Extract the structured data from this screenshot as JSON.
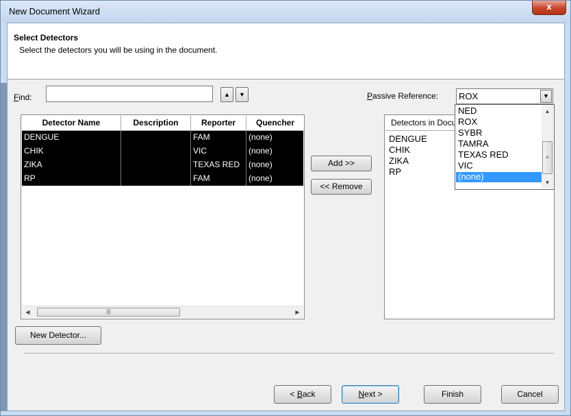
{
  "window": {
    "title": "New Document Wizard",
    "close_label": "x"
  },
  "header": {
    "title": "Select Detectors",
    "subtitle": "Select the detectors you will be using in the document."
  },
  "find": {
    "label_key": "F",
    "label_rest": "ind:",
    "value": "",
    "up_glyph": "▲",
    "down_glyph": "▼"
  },
  "passive_reference": {
    "label_key": "P",
    "label_rest": "assive Reference:",
    "selected": "ROX",
    "options": [
      "NED",
      "ROX",
      "SYBR",
      "TAMRA",
      "TEXAS RED",
      "VIC",
      "(none)"
    ],
    "highlighted": "(none)"
  },
  "detector_table": {
    "columns": [
      "Detector Name",
      "Description",
      "Reporter",
      "Quencher"
    ],
    "rows": [
      {
        "name": "DENGUE",
        "description": "",
        "reporter": "FAM",
        "quencher": "(none)"
      },
      {
        "name": "CHIK",
        "description": "",
        "reporter": "VIC",
        "quencher": "(none)"
      },
      {
        "name": "ZIKA",
        "description": "",
        "reporter": "TEXAS RED",
        "quencher": "(none)"
      },
      {
        "name": "RP",
        "description": "",
        "reporter": "FAM",
        "quencher": "(none)"
      }
    ],
    "selected_rows": 4
  },
  "document_list": {
    "header": "Detectors in Document",
    "items": [
      "DENGUE",
      "CHIK",
      "ZIKA",
      "RP"
    ]
  },
  "buttons": {
    "add": "Add >>",
    "remove": "<< Remove",
    "new_detector": "New Detector...",
    "back_key": "B",
    "back_prefix": "< ",
    "back_rest": "ack",
    "next_key": "N",
    "next_rest": "ext >",
    "finish": "Finish",
    "cancel": "Cancel"
  },
  "colors": {
    "selection_row": "#000000",
    "dropdown_highlight": "#3399ff",
    "close_button": "#c6452c"
  }
}
